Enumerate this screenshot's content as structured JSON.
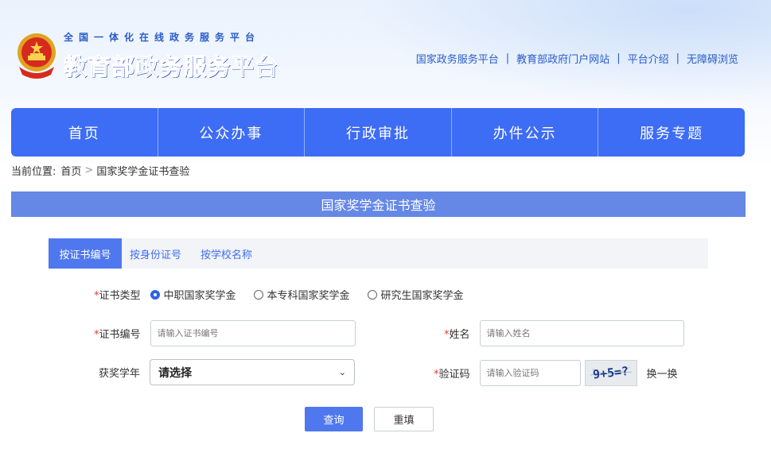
{
  "header": {
    "logo_small": "全国一体化在线政务服务平台",
    "logo_big": "教育部政务服务平台",
    "links": [
      "国家政务服务平台",
      "教育部政府门户网站",
      "平台介绍",
      "无障碍浏览"
    ],
    "link_separator": "|"
  },
  "nav": {
    "items": [
      "首页",
      "公众办事",
      "行政审批",
      "办件公示",
      "服务专题"
    ]
  },
  "breadcrumb": {
    "prefix": "当前位置:",
    "home": "首页",
    "separator": ">",
    "current": "国家奖学金证书查验"
  },
  "page_title": "国家奖学金证书查验",
  "tabs": [
    "按证书编号",
    "按身份证号",
    "按学校名称"
  ],
  "form": {
    "required_mark": "*",
    "cert_type": {
      "label": "证书类型",
      "options": [
        "中职国家奖学金",
        "本专科国家奖学金",
        "研究生国家奖学金"
      ],
      "selected": "中职国家奖学金"
    },
    "cert_no": {
      "label": "证书编号",
      "placeholder": "请输入证书编号"
    },
    "name": {
      "label": "姓名",
      "placeholder": "请输入姓名"
    },
    "year": {
      "label": "获奖学年",
      "value": "请选择"
    },
    "captcha": {
      "label": "验证码",
      "placeholder": "请输入验证码",
      "image_text": "9+5=?",
      "refresh_label": "换一换"
    },
    "buttons": {
      "query": "查询",
      "reset": "重填"
    }
  },
  "colors": {
    "primary": "#3d6cf5",
    "title_bar": "#6588e6",
    "required": "#e23b3b"
  }
}
